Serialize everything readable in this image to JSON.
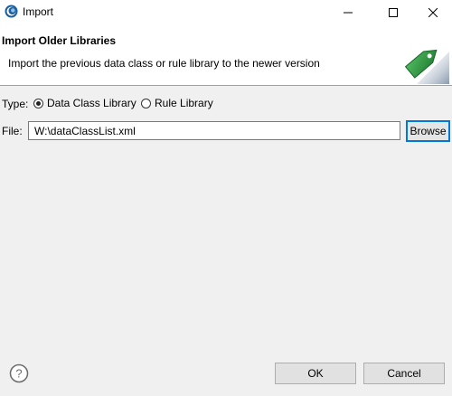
{
  "window": {
    "title": "Import",
    "icon": "eclipse-app-icon"
  },
  "banner": {
    "title": "Import Older Libraries",
    "description": "Import the previous data class or rule library to the newer version",
    "graphic": "green-tag-icon"
  },
  "type_row": {
    "label": "Type:",
    "options": [
      {
        "label": "Data Class Library",
        "checked": true
      },
      {
        "label": "Rule Library",
        "checked": false
      }
    ]
  },
  "file_row": {
    "label": "File:",
    "value": "W:\\dataClassList.xml",
    "browse_label": "Browse"
  },
  "footer": {
    "help_icon": "help-icon",
    "ok_label": "OK",
    "cancel_label": "Cancel"
  },
  "colors": {
    "accent": "#0078d7",
    "tag_green": "#2e8b3e",
    "background": "#f0f0f0"
  }
}
